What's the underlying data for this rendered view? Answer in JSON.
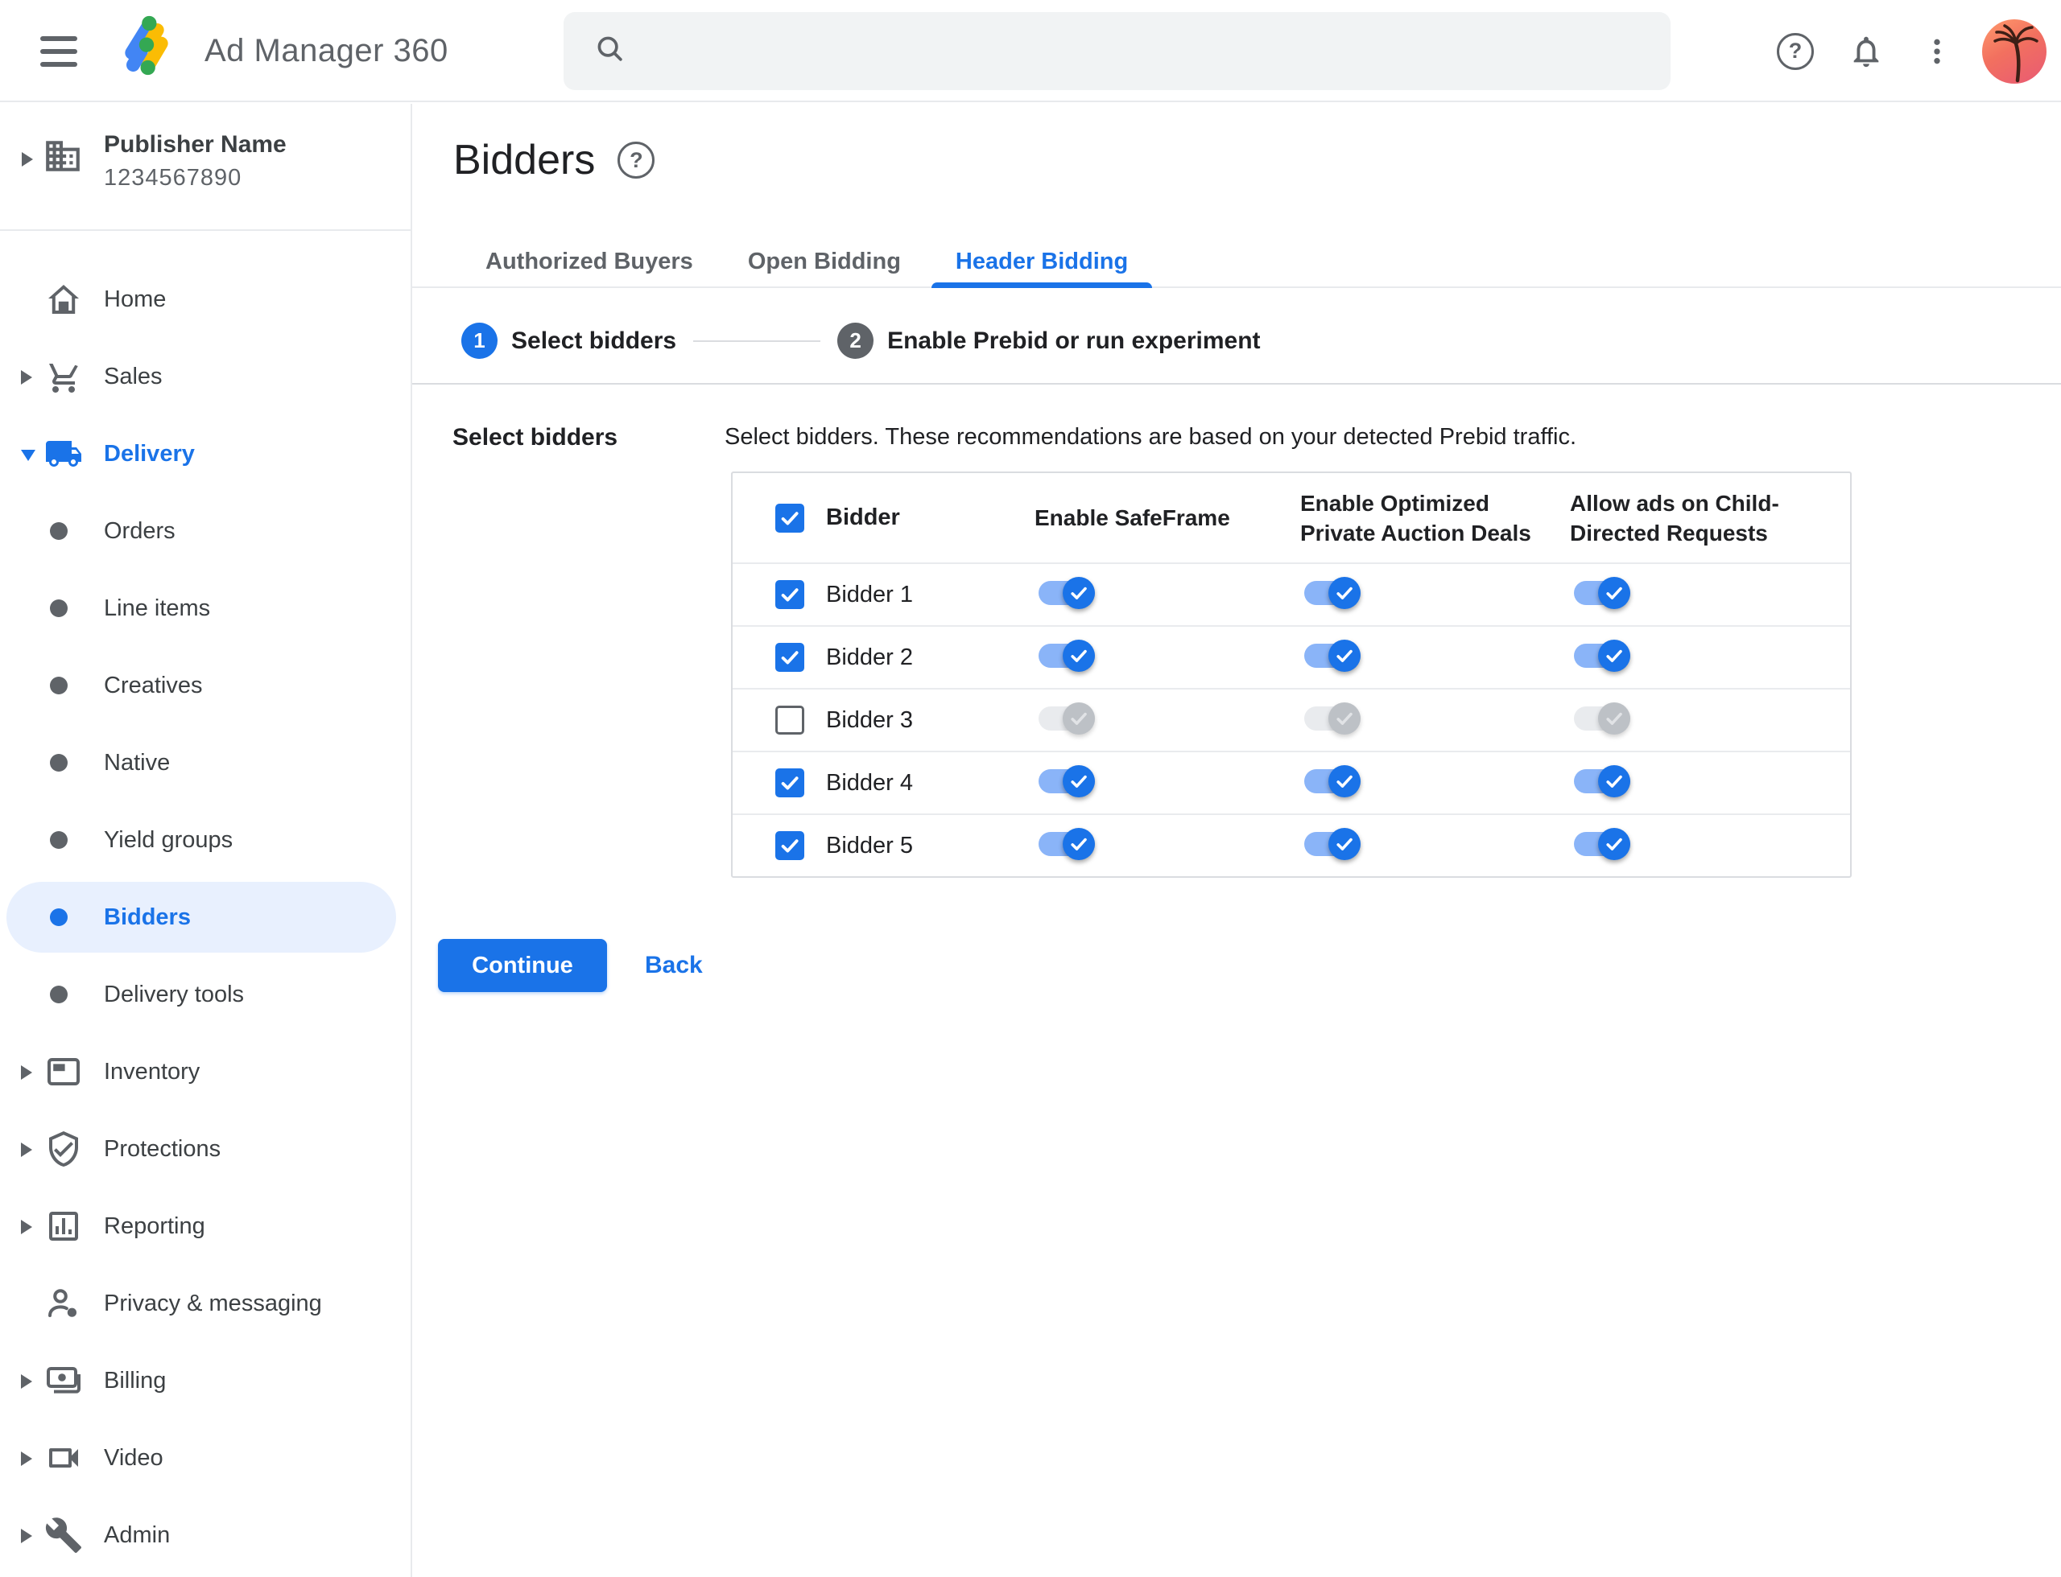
{
  "topbar": {
    "app_title": "Ad Manager 360",
    "search_placeholder": ""
  },
  "sidebar": {
    "publisher": {
      "name": "Publisher Name",
      "id": "1234567890"
    },
    "items": [
      {
        "label": "Home",
        "icon": "home",
        "kind": "main",
        "arrow": null,
        "active": false,
        "selected": false
      },
      {
        "label": "Sales",
        "icon": "cart",
        "kind": "main",
        "arrow": "right",
        "active": false,
        "selected": false
      },
      {
        "label": "Delivery",
        "icon": "truck",
        "kind": "main",
        "arrow": "down",
        "active": true,
        "selected": false
      },
      {
        "label": "Orders",
        "icon": "bullet",
        "kind": "sub",
        "arrow": null,
        "active": false,
        "selected": false
      },
      {
        "label": "Line items",
        "icon": "bullet",
        "kind": "sub",
        "arrow": null,
        "active": false,
        "selected": false
      },
      {
        "label": "Creatives",
        "icon": "bullet",
        "kind": "sub",
        "arrow": null,
        "active": false,
        "selected": false
      },
      {
        "label": "Native",
        "icon": "bullet",
        "kind": "sub",
        "arrow": null,
        "active": false,
        "selected": false
      },
      {
        "label": "Yield groups",
        "icon": "bullet",
        "kind": "sub",
        "arrow": null,
        "active": false,
        "selected": false
      },
      {
        "label": "Bidders",
        "icon": "bullet",
        "kind": "sub",
        "arrow": null,
        "active": true,
        "selected": true
      },
      {
        "label": "Delivery tools",
        "icon": "bullet",
        "kind": "sub",
        "arrow": null,
        "active": false,
        "selected": false
      },
      {
        "label": "Inventory",
        "icon": "ad-unit",
        "kind": "main",
        "arrow": "right",
        "active": false,
        "selected": false
      },
      {
        "label": "Protections",
        "icon": "shield-check",
        "kind": "main",
        "arrow": "right",
        "active": false,
        "selected": false
      },
      {
        "label": "Reporting",
        "icon": "bar-chart",
        "kind": "main",
        "arrow": "right",
        "active": false,
        "selected": false
      },
      {
        "label": "Privacy & messaging",
        "icon": "person-badge",
        "kind": "main",
        "arrow": null,
        "active": false,
        "selected": false
      },
      {
        "label": "Billing",
        "icon": "payments",
        "kind": "main",
        "arrow": "right",
        "active": false,
        "selected": false
      },
      {
        "label": "Video",
        "icon": "videocam",
        "kind": "main",
        "arrow": "right",
        "active": false,
        "selected": false
      },
      {
        "label": "Admin",
        "icon": "wrench",
        "kind": "main",
        "arrow": "right",
        "active": false,
        "selected": false
      }
    ]
  },
  "page": {
    "title": "Bidders"
  },
  "tabs": [
    {
      "label": "Authorized Buyers",
      "active": false
    },
    {
      "label": "Open Bidding",
      "active": false
    },
    {
      "label": "Header Bidding",
      "active": true
    }
  ],
  "stepper": {
    "steps": [
      {
        "number": "1",
        "label": "Select bidders",
        "active": true
      },
      {
        "number": "2",
        "label": "Enable Prebid or run experiment",
        "active": false
      }
    ]
  },
  "form": {
    "section_label": "Select bidders",
    "description": "Select bidders. These recommendations are based on your detected Prebid traffic."
  },
  "table": {
    "columns": [
      "Bidder",
      "Enable SafeFrame",
      "Enable Optimized Private Auction Deals",
      "Allow ads on Child-Directed Requests"
    ],
    "header_checkbox_checked": true,
    "rows": [
      {
        "name": "Bidder 1",
        "selected": true,
        "safeframe": true,
        "optimized_private_auction": true,
        "child_directed": true
      },
      {
        "name": "Bidder 2",
        "selected": true,
        "safeframe": true,
        "optimized_private_auction": true,
        "child_directed": true
      },
      {
        "name": "Bidder 3",
        "selected": false,
        "safeframe": false,
        "optimized_private_auction": false,
        "child_directed": false
      },
      {
        "name": "Bidder 4",
        "selected": true,
        "safeframe": true,
        "optimized_private_auction": true,
        "child_directed": true
      },
      {
        "name": "Bidder 5",
        "selected": true,
        "safeframe": true,
        "optimized_private_auction": true,
        "child_directed": true
      }
    ]
  },
  "actions": {
    "continue_label": "Continue",
    "back_label": "Back"
  },
  "colors": {
    "accent_blue": "#1a73e8",
    "toggle_track_on": "#8ab4f8",
    "toggle_track_off": "#e9ebee",
    "toggle_thumb_off": "#bdc1c6",
    "selected_item_bg": "#e8f0fe",
    "icon_gray": "#5f6368",
    "text_dark": "#202124",
    "border_gray": "#dadce0",
    "search_bg": "#f1f3f4"
  }
}
